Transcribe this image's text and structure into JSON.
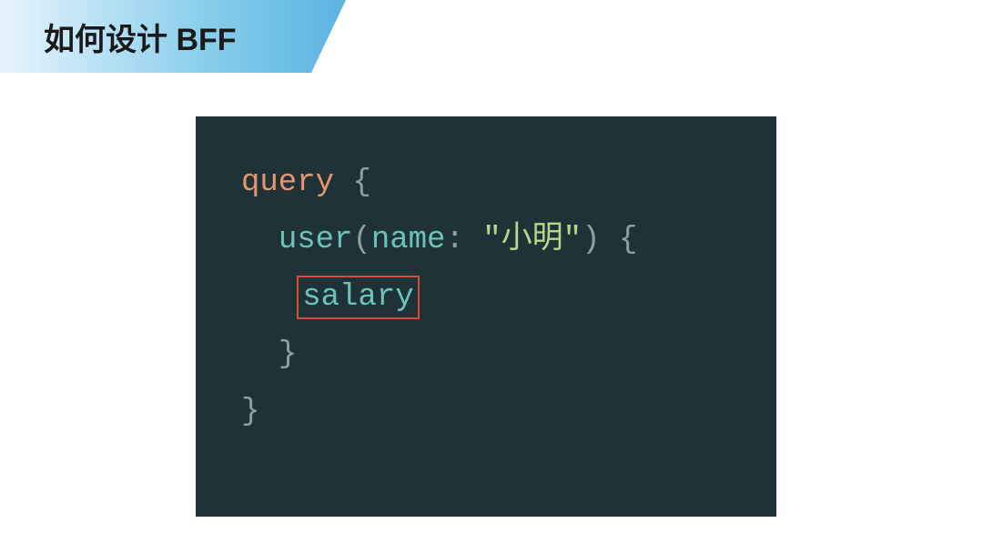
{
  "header": {
    "title": "如何设计 BFF"
  },
  "code": {
    "keyword_query": "query",
    "brace_open": "{",
    "brace_close": "}",
    "field_user": "user",
    "paren_open": "(",
    "param_name": "name",
    "colon": ":",
    "string_value": "\"小明\"",
    "paren_close": ")",
    "field_salary": "salary"
  }
}
